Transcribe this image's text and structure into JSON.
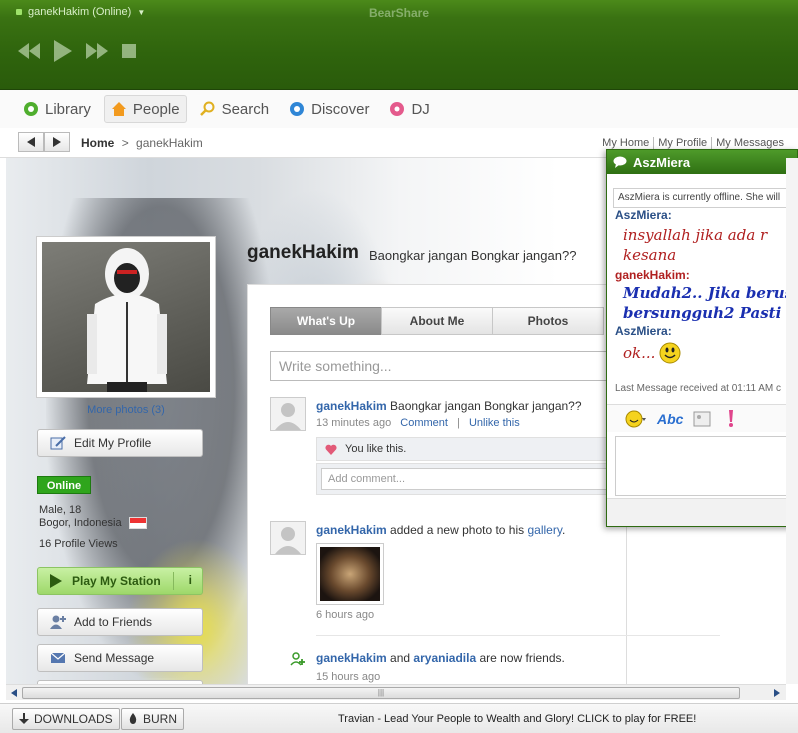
{
  "titlebar": {
    "status": "ganekHakim (Online)",
    "brand": "BearShare"
  },
  "nav": {
    "tabs": [
      {
        "label": "Library",
        "icon": "library-icon"
      },
      {
        "label": "People",
        "icon": "home-icon"
      },
      {
        "label": "Search",
        "icon": "search-icon"
      },
      {
        "label": "Discover",
        "icon": "discover-icon"
      },
      {
        "label": "DJ",
        "icon": "dj-icon"
      }
    ],
    "active": "People"
  },
  "breadcrumb": {
    "home": "Home",
    "separator": ">",
    "current": "ganekHakim"
  },
  "toplinks": [
    "My Home",
    "My Profile",
    "My Messages"
  ],
  "profile": {
    "name": "ganekHakim",
    "status": "Baongkar jangan Bongkar jangan??",
    "more_photos": "More photos (3)",
    "edit_profile": "Edit My Profile",
    "online": "Online",
    "gender_age": "Male, 18",
    "location": "Bogor, Indonesia",
    "views": "16 Profile Views",
    "play_station": "Play My Station",
    "add_friends": "Add to Friends",
    "send_message": "Send Message"
  },
  "content": {
    "tabs": [
      "What's Up",
      "About Me",
      "Photos"
    ],
    "active_tab": "What's Up",
    "write_placeholder": "Write something...",
    "posts": [
      {
        "user": "ganekHakim",
        "text": "Baongkar jangan Bongkar jangan??",
        "time": "13 minutes ago",
        "comment": "Comment",
        "unlike": "Unlike this",
        "likes": "You like this.",
        "add_comment": "Add comment..."
      },
      {
        "user": "ganekHakim",
        "text_pre": "added a new photo to his",
        "link": "gallery",
        "text_post": ".",
        "time": "6 hours ago"
      },
      {
        "user": "ganekHakim",
        "text": "and",
        "friend": "aryaniadila",
        "text_post": "are now friends.",
        "time": "15 hours ago"
      }
    ]
  },
  "chat": {
    "title": "AszMiera",
    "offline_notice": "AszMiera is currently offline. She will",
    "messages": [
      {
        "user": "AszMiera:",
        "lines": [
          "insyallah jika ada r",
          "kesana"
        ],
        "color": "#b02020"
      },
      {
        "user": "ganekHakim:",
        "lines": [
          "Mudah2.. Jika berus",
          "bersungguh2 Pasti s"
        ],
        "color": "#1a2fb0"
      },
      {
        "user": "AszMiera:",
        "lines": [
          "ok..."
        ],
        "color": "#b02020"
      }
    ],
    "last_message": "Last Message received at 01:11 AM c",
    "font_tool": "Abc"
  },
  "statusbar": {
    "downloads": "DOWNLOADS",
    "burn": "BURN",
    "ad": "Travian - Lead Your People to Wealth and Glory! CLICK to play for FREE!"
  },
  "colors": {
    "accent_green": "#2f640d",
    "online_green": "#2fa51c",
    "link_blue": "#3366aa"
  }
}
